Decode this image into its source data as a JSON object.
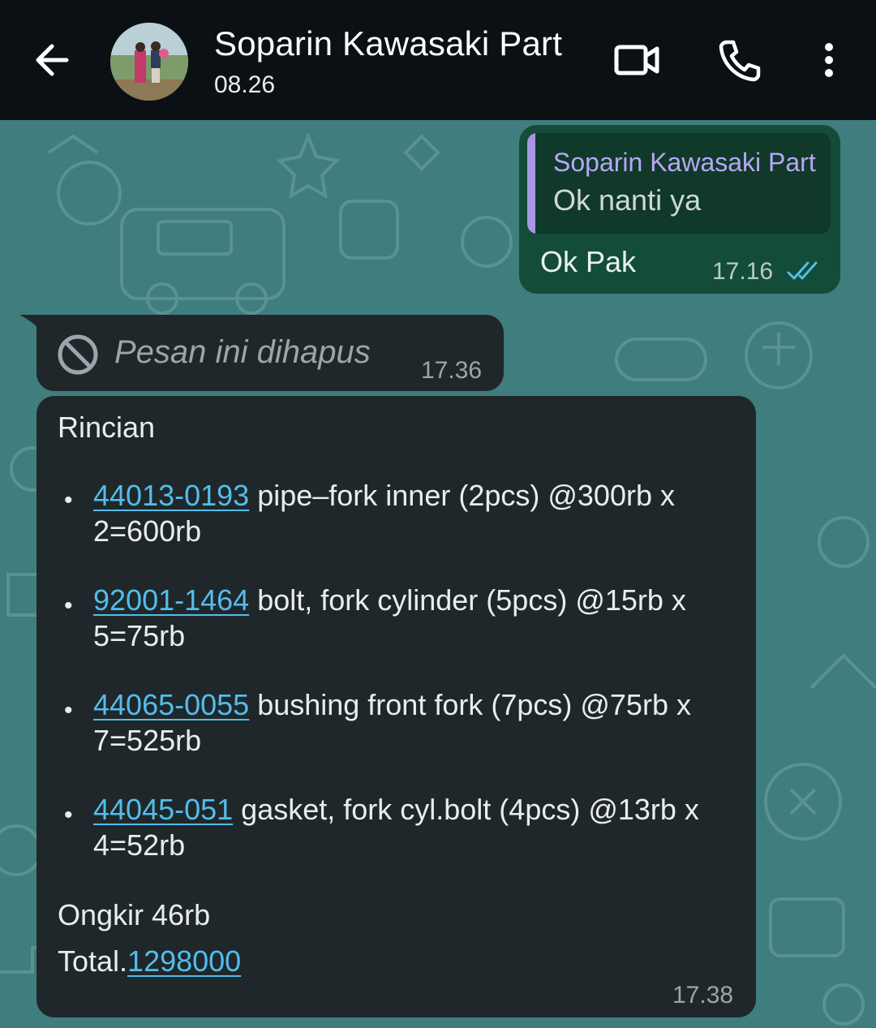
{
  "header": {
    "contact_name": "Soparin Kawasaki Part",
    "status": "08.26",
    "icons": [
      "back-arrow-icon",
      "video-call-icon",
      "phone-icon",
      "more-vert-icon"
    ]
  },
  "messages": {
    "outgoing": {
      "quote_name": "Soparin Kawasaki Part",
      "quote_text": "Ok nanti ya",
      "text": "Ok Pak",
      "time": "17.16"
    },
    "deleted": {
      "text": "Pesan ini dihapus",
      "time": "17.36"
    },
    "detail": {
      "heading": "Rincian",
      "items": [
        {
          "code": "44013-0193",
          "text": " pipe–fork inner (2pcs)  @300rb x",
          "cont": "2=600rb"
        },
        {
          "code": "92001-1464",
          "text": " bolt, fork cylinder (5pcs) @15rb x",
          "cont": "5=75rb"
        },
        {
          "code": "44065-0055",
          "text": " bushing front fork (7pcs) @75rb x",
          "cont": "7=525rb"
        },
        {
          "code": "44045-051",
          "text": " gasket, fork cyl.bolt (4pcs) @13rb x",
          "cont": "4=52rb"
        }
      ],
      "shipping": "Ongkir 46rb",
      "total_label": "Total.",
      "total_value": "1298000",
      "time": "17.38"
    }
  },
  "colors": {
    "header_bg": "#0b1014",
    "wallpaper": "#3f7d7e",
    "outgoing_bubble": "#144d37",
    "incoming_bubble": "#1f272a",
    "link": "#53bdeb",
    "read_ticks": "#53bdeb",
    "quote_accent": "#a895e6"
  }
}
